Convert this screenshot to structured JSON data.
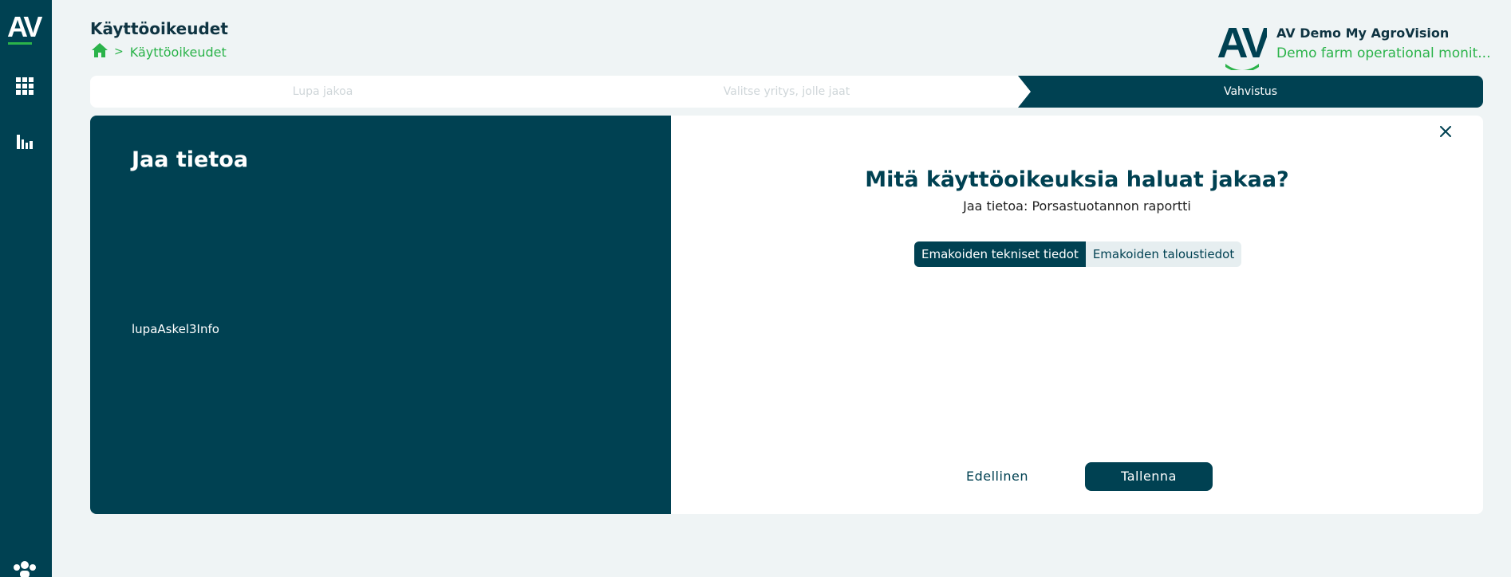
{
  "sidebar": {
    "logo_text": "AV",
    "items": [
      {
        "icon": "apps-grid-icon"
      },
      {
        "icon": "bar-chart-icon"
      },
      {
        "icon": "users-icon"
      }
    ]
  },
  "header": {
    "title": "Käyttöoikeudet",
    "breadcrumb": {
      "home_icon": "home-icon",
      "separator": ">",
      "current": "Käyttöoikeudet"
    }
  },
  "account": {
    "avatar_text": "AV",
    "name": "AV Demo My AgroVision",
    "farm": "Demo farm operational monit..."
  },
  "stepper": {
    "steps": [
      {
        "label": "Lupa jakoa",
        "active": false
      },
      {
        "label": "Valitse yritys, jolle jaat",
        "active": false
      },
      {
        "label": "Vahvistus",
        "active": true
      }
    ]
  },
  "info_panel": {
    "title": "Jaa tietoa",
    "text": "lupaAskel3Info"
  },
  "main": {
    "question": "Mitä käyttöoikeuksia haluat jakaa?",
    "subtitle": "Jaa tietoa: Porsastuotannon raportti",
    "tabs": [
      {
        "label": "Emakoiden tekniset tiedot",
        "active": true
      },
      {
        "label": "Emakoiden taloustiedot",
        "active": false
      }
    ],
    "prev_label": "Edellinen",
    "save_label": "Tallenna"
  },
  "colors": {
    "primary": "#004152",
    "accent": "#2bb34a",
    "background": "#eff4f5"
  }
}
